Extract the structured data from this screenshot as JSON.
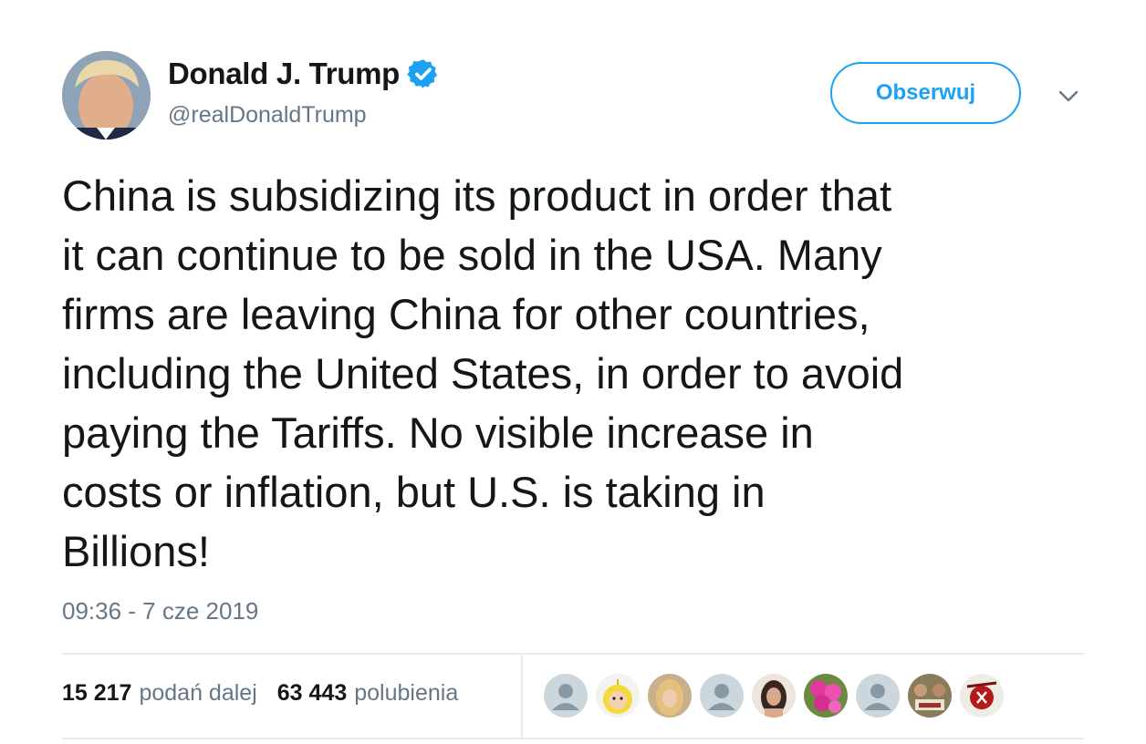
{
  "author": {
    "display_name": "Donald J. Trump",
    "handle": "@realDonaldTrump",
    "verified_icon": "verified-badge-icon"
  },
  "follow_button_label": "Obserwuj",
  "tweet": {
    "lines": [
      "China is subsidizing its product in order that",
      "it can continue to be sold in the USA. Many",
      "firms are leaving China for other countries,",
      "including the United States, in order to avoid",
      "paying the Tariffs. No visible increase in",
      "costs or inflation, but U.S. is taking in",
      "Billions!"
    ],
    "timestamp": "09:36 - 7 cze 2019"
  },
  "stats": {
    "retweets_count": "15 217",
    "retweets_label": "podań dalej",
    "likes_count": "63 443",
    "likes_label": "polubienia"
  },
  "likers": [
    {
      "kind": "default-avatar"
    },
    {
      "kind": "photo-avatar"
    },
    {
      "kind": "photo-avatar"
    },
    {
      "kind": "default-avatar"
    },
    {
      "kind": "photo-avatar"
    },
    {
      "kind": "photo-avatar"
    },
    {
      "kind": "default-avatar"
    },
    {
      "kind": "photo-avatar"
    },
    {
      "kind": "photo-avatar"
    }
  ],
  "colors": {
    "accent": "#1da1f2",
    "text": "#14171a",
    "secondary": "#657786",
    "divider": "#e6ecf0"
  }
}
